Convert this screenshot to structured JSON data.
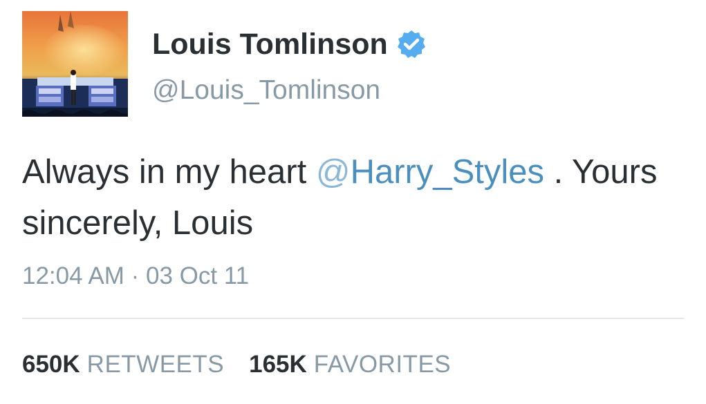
{
  "user": {
    "display_name": "Louis Tomlinson",
    "handle": "@Louis_Tomlinson",
    "verified": true,
    "avatar_icon": "concert-stage-avatar"
  },
  "tweet": {
    "text_before": "Always in my heart ",
    "mention_at": "@",
    "mention_name": "Harry_Styles",
    "text_after": " . Yours sincerely, Louis",
    "timestamp": "12:04 AM · 03 Oct 11"
  },
  "stats": {
    "retweets_count": "650K",
    "retweets_label": "RETWEETS",
    "favorites_count": "165K",
    "favorites_label": "FAVORITES"
  },
  "colors": {
    "link": "#4a8fbd",
    "verified": "#55acee",
    "muted": "#8899a6",
    "text": "#292f33"
  }
}
